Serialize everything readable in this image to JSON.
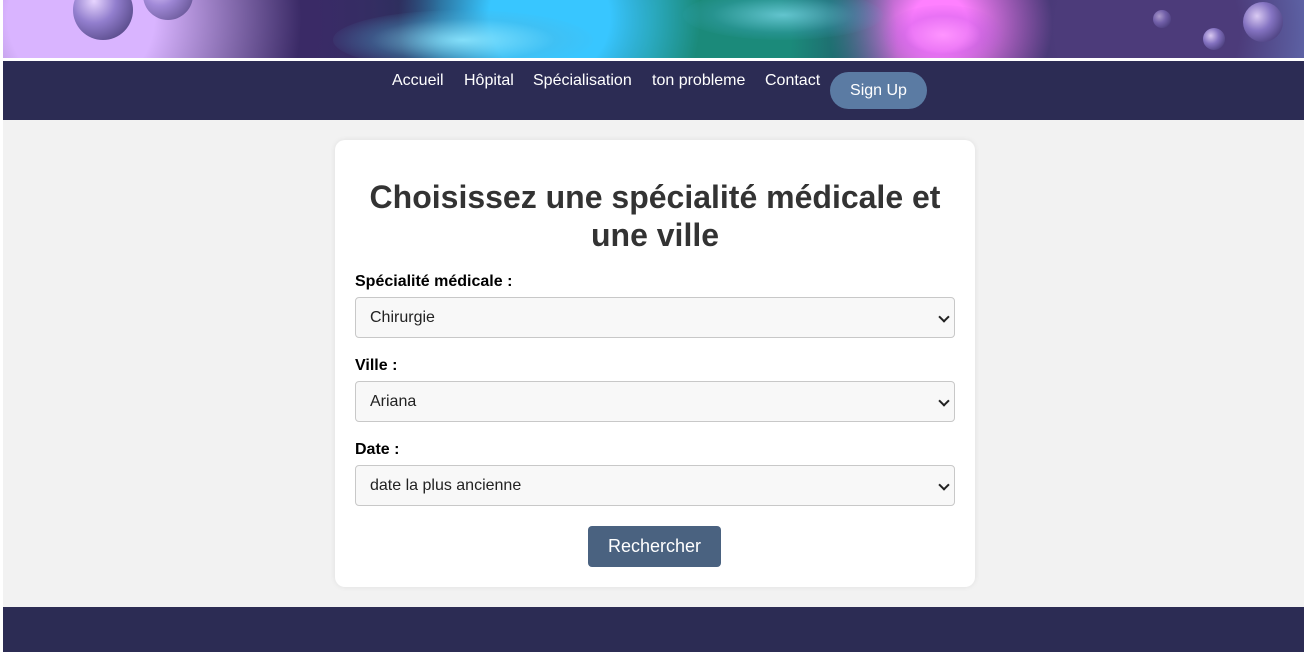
{
  "nav": {
    "links": [
      "Accueil",
      "Hôpital",
      "Spécialisation",
      "ton probleme",
      "Contact"
    ],
    "signup_label": "Sign Up"
  },
  "form": {
    "title": "Choisissez une spécialité médicale et une ville",
    "specialty": {
      "label": "Spécialité médicale :",
      "value": "Chirurgie"
    },
    "city": {
      "label": "Ville :",
      "value": "Ariana"
    },
    "date": {
      "label": "Date :",
      "value": "date la plus ancienne"
    },
    "submit_label": "Rechercher"
  },
  "colors": {
    "nav_bg": "#2c2c54",
    "signup_bg": "#5b7ba3",
    "button_bg": "#4a6280",
    "page_bg": "#f2f2f2"
  }
}
